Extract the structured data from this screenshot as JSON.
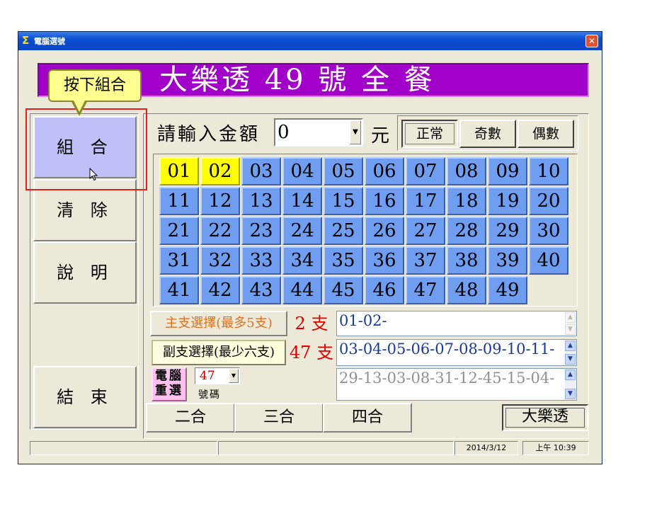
{
  "window": {
    "title": "電腦選號",
    "title_icon": "Σ",
    "close_glyph": "✕"
  },
  "banner": {
    "title": "大樂透 49 號 全 餐"
  },
  "callout": {
    "text": "按下組合"
  },
  "sidebar": {
    "combine": "組 合",
    "clear": "清 除",
    "help": "說 明",
    "exit": "結 束"
  },
  "amount": {
    "label": "請輸入金額",
    "value": "0",
    "unit": "元"
  },
  "modes": [
    "正常",
    "奇數",
    "偶數"
  ],
  "numbers": [
    "01",
    "02",
    "03",
    "04",
    "05",
    "06",
    "07",
    "08",
    "09",
    "10",
    "11",
    "12",
    "13",
    "14",
    "15",
    "16",
    "17",
    "18",
    "19",
    "20",
    "21",
    "22",
    "23",
    "24",
    "25",
    "26",
    "27",
    "28",
    "29",
    "30",
    "31",
    "32",
    "33",
    "34",
    "35",
    "36",
    "37",
    "38",
    "39",
    "40",
    "41",
    "42",
    "43",
    "44",
    "45",
    "46",
    "47",
    "48",
    "49"
  ],
  "selected_numbers": [
    "01",
    "02"
  ],
  "main_pick": {
    "label": "主支選擇(最多5支)",
    "count": "2 支",
    "value": "01-02-"
  },
  "sub_pick": {
    "label": "副支選擇(最少六支)",
    "count": "47 支",
    "value": "03-04-05-06-07-08-09-10-11-"
  },
  "computer_pick": {
    "button_line1": "電腦",
    "button_line2": "重選",
    "count": "47",
    "unit": "號碼",
    "value": "29-13-03-08-31-12-45-15-04-"
  },
  "combos": [
    "二合",
    "三合",
    "四合"
  ],
  "lotto_button": "大樂透",
  "status": {
    "date": "2014/3/12",
    "time": "上午 10:39"
  },
  "colors": {
    "banner": "#a000c8",
    "number_cell": "#6f9df0",
    "selected_cell": "#ffff00",
    "highlight": "#e02020"
  }
}
